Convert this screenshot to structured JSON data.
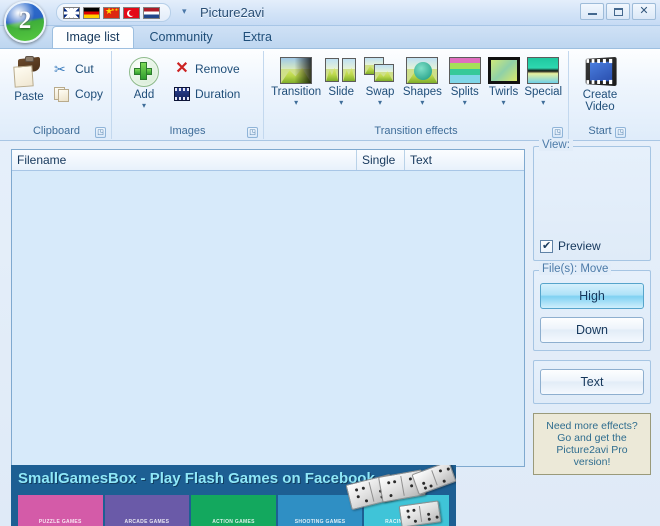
{
  "window": {
    "title": "Picture2avi",
    "logo_glyph": "2",
    "quick_access_dropdown": "▾",
    "controls": {
      "minimize": "minimize-icon",
      "maximize": "maximize-icon",
      "close": "✕"
    }
  },
  "languages": [
    {
      "name": "english",
      "icon": "flag-uk-icon"
    },
    {
      "name": "german",
      "icon": "flag-de-icon"
    },
    {
      "name": "chinese",
      "icon": "flag-cn-icon"
    },
    {
      "name": "turkish",
      "icon": "flag-tr-icon"
    },
    {
      "name": "dutch",
      "icon": "flag-nl-icon"
    }
  ],
  "tabs": [
    {
      "label": "Image list",
      "active": true
    },
    {
      "label": "Community",
      "active": false
    },
    {
      "label": "Extra",
      "active": false
    }
  ],
  "ribbon": {
    "groups": [
      {
        "title": "Clipboard",
        "big_button": {
          "label": "Paste",
          "icon": "paste-icon"
        },
        "small_buttons": [
          {
            "label": "Cut",
            "icon": "scissors-icon"
          },
          {
            "label": "Copy",
            "icon": "copy-icon"
          }
        ],
        "has_launcher": true,
        "launcher_glyph": "◳"
      },
      {
        "title": "Images",
        "big_button": {
          "label": "Add",
          "icon": "plus-icon",
          "dropdown": "▾"
        },
        "small_buttons": [
          {
            "label": "Remove",
            "icon": "remove-icon"
          },
          {
            "label": "Duration",
            "icon": "duration-icon"
          }
        ],
        "has_launcher": true,
        "launcher_glyph": "◳"
      },
      {
        "title": "Transition effects",
        "effects": [
          {
            "label": "Transition",
            "dropdown": "▾"
          },
          {
            "label": "Slide",
            "dropdown": "▾"
          },
          {
            "label": "Swap",
            "dropdown": "▾"
          },
          {
            "label": "Shapes",
            "dropdown": "▾"
          },
          {
            "label": "Splits",
            "dropdown": "▾"
          },
          {
            "label": "Twirls",
            "dropdown": "▾"
          },
          {
            "label": "Special",
            "dropdown": "▾"
          }
        ],
        "has_launcher": true,
        "launcher_glyph": "◳"
      },
      {
        "title": "Start",
        "big_button": {
          "label": "Create Video",
          "icon": "film-icon"
        },
        "has_launcher": true,
        "launcher_glyph": "◳"
      }
    ]
  },
  "list": {
    "columns": [
      {
        "label": "Filename"
      },
      {
        "label": "Single"
      },
      {
        "label": "Text"
      }
    ],
    "rows": []
  },
  "side": {
    "view_panel": {
      "title": "View:",
      "preview_checkbox": {
        "label": "Preview",
        "checked": true
      }
    },
    "move_panel": {
      "title": "File(s): Move",
      "buttons": [
        {
          "label": "High",
          "highlighted": true
        },
        {
          "label": "Down",
          "highlighted": false
        }
      ]
    },
    "text_panel": {
      "buttons": [
        {
          "label": "Text",
          "highlighted": false
        }
      ]
    },
    "promo": {
      "lines": [
        "Need more effects?",
        "Go and get the",
        "Picture2avi Pro",
        "version!"
      ]
    }
  },
  "banner": {
    "headline": "SmallGamesBox - Play Flash Games on Facebook",
    "tiles": [
      {
        "label": "PUZZLE GAMES",
        "color": "#d45ba8"
      },
      {
        "label": "ARCADE GAMES",
        "color": "#6a5aa8"
      },
      {
        "label": "ACTION GAMES",
        "color": "#13a85e"
      },
      {
        "label": "SHOOTING GAMES",
        "color": "#2f8fc4"
      },
      {
        "label": "RACING GAMES",
        "color": "#3fc4d8"
      }
    ]
  },
  "colors": {
    "accent": "#1d5f93",
    "ribbon_text": "#1f4e79",
    "list_bg": "#d7eafa",
    "banner_text": "#8fe8f8"
  }
}
